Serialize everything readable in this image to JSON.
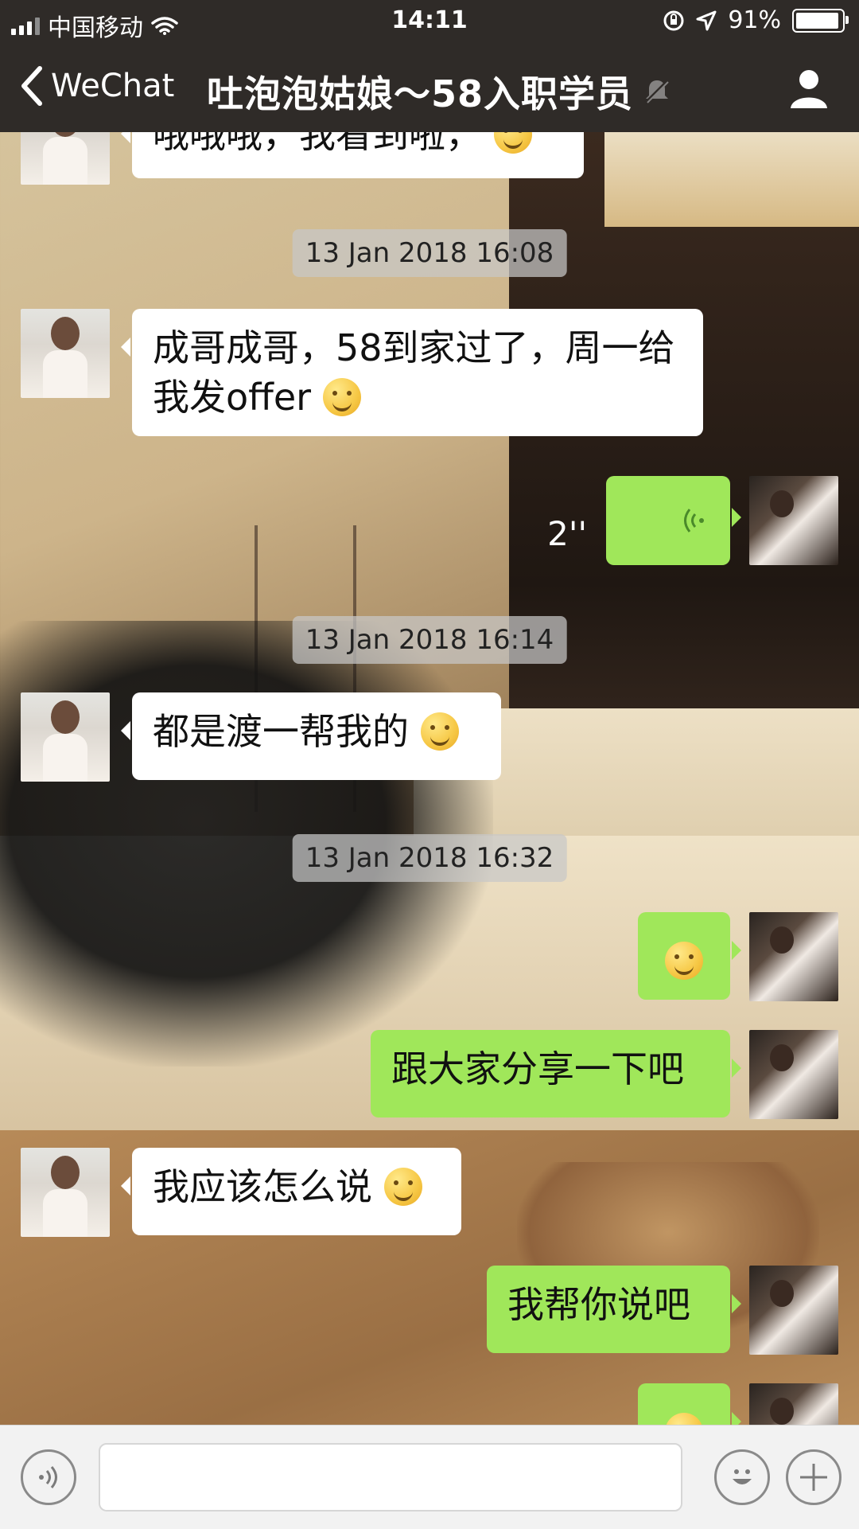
{
  "status_bar": {
    "carrier": "中国移动",
    "time": "14:11",
    "battery_percent": "91%",
    "icons": [
      "signal-icon",
      "wifi-icon",
      "orientation-lock-icon",
      "location-icon",
      "battery-icon"
    ]
  },
  "nav": {
    "back_label": "WeChat",
    "title": "吐泡泡姑娘～58入职学员",
    "icons": [
      "back-chevron-icon",
      "mute-icon",
      "profile-icon"
    ]
  },
  "messages": [
    {
      "type": "text",
      "from": "other",
      "text": "哦哦哦，我看到啦，"
    },
    {
      "type": "timestamp",
      "text": "13 Jan 2018 16:08"
    },
    {
      "type": "text",
      "from": "other",
      "text": "成哥成哥，58到家过了，周一给我发offer"
    },
    {
      "type": "voice",
      "from": "me",
      "duration": "2''"
    },
    {
      "type": "timestamp",
      "text": "13 Jan 2018 16:14"
    },
    {
      "type": "text",
      "from": "other",
      "text": "都是渡一帮我的"
    },
    {
      "type": "timestamp",
      "text": "13 Jan 2018 16:32"
    },
    {
      "type": "emoji",
      "from": "me",
      "emoji": "smile"
    },
    {
      "type": "text",
      "from": "me",
      "text": "跟大家分享一下吧"
    },
    {
      "type": "text",
      "from": "other",
      "text": "我应该怎么说"
    },
    {
      "type": "text",
      "from": "me",
      "text": "我帮你说吧"
    },
    {
      "type": "emoji",
      "from": "me",
      "emoji": "smile"
    }
  ],
  "input_bar": {
    "placeholder": "",
    "icons": [
      "voice-input-icon",
      "emoji-icon",
      "plus-icon"
    ]
  },
  "colors": {
    "bar_bg": "#2f2b28",
    "bubble_out": "#a0e75a",
    "bubble_in": "#ffffff"
  }
}
